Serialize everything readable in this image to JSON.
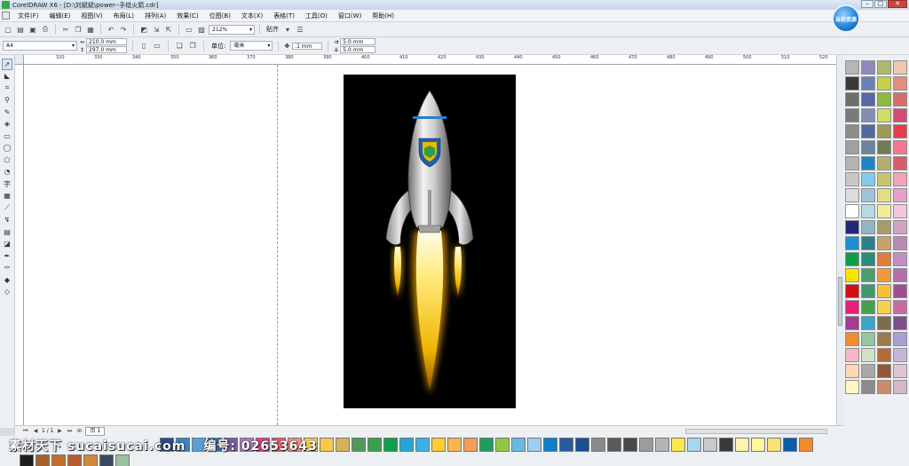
{
  "window": {
    "title": "CorelDRAW X6 - [D:\\刘斌斌\\power--手绘火箭.cdr]",
    "controls": [
      "–",
      "□",
      "✕"
    ]
  },
  "menu": [
    "文件(F)",
    "编辑(E)",
    "视图(V)",
    "布局(L)",
    "排列(A)",
    "效果(C)",
    "位图(B)",
    "文本(X)",
    "表格(T)",
    "工具(O)",
    "窗口(W)",
    "帮助(H)"
  ],
  "badge_text": "当前资源",
  "toolbar": {
    "zoom": "212%",
    "snap_label": "贴齐"
  },
  "property_bar": {
    "paper_size": "A4",
    "width": "210.0 mm",
    "height": "297.0 mm",
    "units_label": "单位:",
    "units": "毫米",
    "nudge": ".1 mm",
    "dup_x": "5.0 mm",
    "dup_y": "5.0 mm"
  },
  "ruler_ticks": [
    "320",
    "330",
    "340",
    "350",
    "360",
    "370",
    "380",
    "390",
    "400",
    "410",
    "420",
    "430",
    "440",
    "450",
    "460",
    "470",
    "480",
    "490",
    "500",
    "510",
    "520"
  ],
  "page_nav": {
    "counter": "1 / 1",
    "tab": "页 1"
  },
  "palette_right": [
    [
      "#b6b6b6",
      "#3a3a3a",
      "#6d6d6d",
      "#7a7a7a",
      "#8b8b8b",
      "#a0a0a0",
      "#b4b4b4",
      "#c8c8c8",
      "#dcdcdc",
      "#ffffff",
      "#1f2a7a",
      "#1b8fd1",
      "#0d9e4b",
      "#fde300",
      "#d20f16",
      "#e81e78",
      "#a33c93",
      "#f08d2c",
      "#f7b5c6",
      "#ffd7b0",
      "#fff6c2"
    ],
    [
      "#8d89bd",
      "#6b82b8",
      "#5967a8",
      "#7f8fb5",
      "#4f6aa4",
      "#6c84a0",
      "#1d86c9",
      "#86c9ee",
      "#9ec4d9",
      "#b7d9e6",
      "#8fb6c7",
      "#2f7f8d",
      "#2a8c79",
      "#4aa06c",
      "#3f9a6e",
      "#41a34f",
      "#3aa6c7",
      "#95c6a0",
      "#cfe3c3",
      "#a8a8a8",
      "#8c8c8c"
    ],
    [
      "#afb96a",
      "#c7d044",
      "#8fb93a",
      "#d1dc65",
      "#9e9a55",
      "#6d7c52",
      "#b5ac6e",
      "#c9c36e",
      "#e3de84",
      "#f2eb9a",
      "#a89b67",
      "#c9a16b",
      "#e07d3b",
      "#f39838",
      "#f5c138",
      "#f6d24c",
      "#7d6d4f",
      "#9e7a4a",
      "#b46d3a",
      "#8e5a3a",
      "#c98b6b"
    ],
    [
      "#f2c7b0",
      "#e68d7a",
      "#d86d6a",
      "#d34a74",
      "#e63c4b",
      "#f2788f",
      "#d85c6a",
      "#f2a3b5",
      "#e7a0c8",
      "#f3c5da",
      "#d2a3c7",
      "#b88ab8",
      "#c28fc0",
      "#b46ea8",
      "#9f4f8e",
      "#c96c9c",
      "#7b4f8e",
      "#a6a1cf",
      "#c2b7da",
      "#e0c3d6",
      "#d4b9c7"
    ]
  ],
  "palette_bottom": [
    "#2b4a8e",
    "#3a82c4",
    "#56a0d6",
    "#2f6aa6",
    "#7a5aa8",
    "#b07ac8",
    "#e83c8c",
    "#ee5a6a",
    "#f5907a",
    "#ffd24c",
    "#f6c94c",
    "#d8b25a",
    "#4f9a5a",
    "#3aa04c",
    "#0e9f4e",
    "#21a7d8",
    "#3db0e3",
    "#ffcc33",
    "#f7b54c",
    "#f39e5a",
    "#1f9e5a",
    "#90c844",
    "#68b8e2",
    "#9ecff0",
    "#0e7fc8",
    "#2a5aa0",
    "#1d4e8e",
    "#8a8a8a",
    "#5a5a5a",
    "#4a4a4a",
    "#9c9c9c",
    "#b5b5b5",
    "#ffe84c",
    "#a9d5ee",
    "#c9c9c9",
    "#3a3a3a",
    "#fff3b0",
    "#fff6a0",
    "#f9e27a",
    "#0a5aa8",
    "#f28c28"
  ],
  "palette_bottom2": [
    "#1e1e1e",
    "#a6622a",
    "#c26e2a",
    "#b85a2a",
    "#d08a3a",
    "#3b4a5e",
    "#9ac0a0"
  ],
  "watermark": {
    "text": "素材天下 sucaisucai.com",
    "code": "编号: 02653643"
  }
}
